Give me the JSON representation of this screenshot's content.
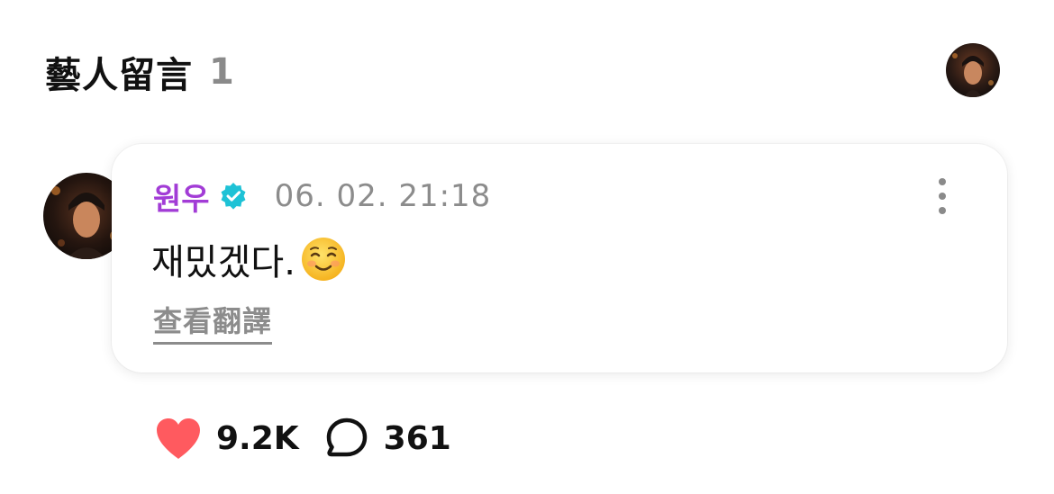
{
  "header": {
    "title": "藝人留言",
    "count": "1"
  },
  "comment": {
    "author": "원우",
    "verified": true,
    "timestamp": "06. 02. 21:18",
    "text": "재밌겠다.",
    "emoji": "relieved-smiling-face",
    "translate_label": "查看翻譯",
    "likes": "9.2K",
    "replies": "361"
  },
  "colors": {
    "author": "#a23cd6",
    "verified_badge": "#1ec2d6",
    "like_heart": "#ff5a5f",
    "muted_text": "#8c8c8c"
  },
  "icons": [
    "more-vertical-icon",
    "verified-badge-icon",
    "heart-icon",
    "speech-bubble-icon"
  ]
}
